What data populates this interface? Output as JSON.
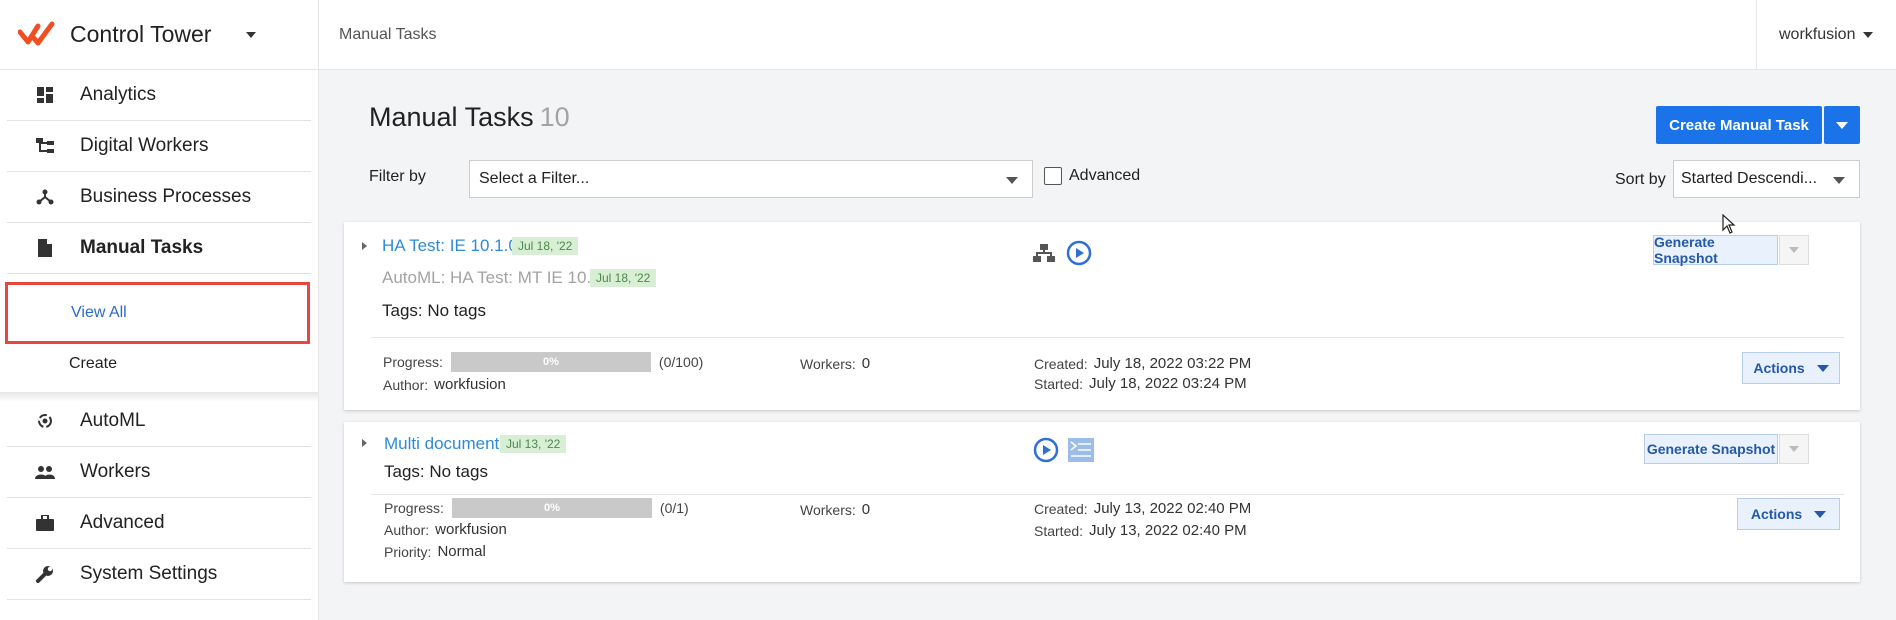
{
  "app": {
    "title": "Control Tower"
  },
  "header": {
    "breadcrumb": "Manual Tasks",
    "user": "workfusion"
  },
  "sidebar": {
    "items": [
      {
        "label": "Analytics",
        "icon": "dashboard-icon"
      },
      {
        "label": "Digital Workers",
        "icon": "workers-tree-icon"
      },
      {
        "label": "Business Processes",
        "icon": "process-graph-icon"
      },
      {
        "label": "Manual Tasks",
        "icon": "document-icon"
      },
      {
        "label": "AutoML",
        "icon": "automl-icon"
      },
      {
        "label": "Workers",
        "icon": "people-icon"
      },
      {
        "label": "Advanced",
        "icon": "briefcase-icon"
      },
      {
        "label": "System Settings",
        "icon": "wrench-icon"
      }
    ],
    "sub_items": [
      {
        "label": "View All"
      },
      {
        "label": "Create"
      }
    ]
  },
  "page": {
    "title": "Manual Tasks",
    "count": "10",
    "create_label": "Create Manual Task",
    "filter_label": "Filter by",
    "filter_value": "Select a Filter...",
    "advanced_label": "Advanced",
    "sort_label": "Sort by",
    "sort_value": "Started Descendi..."
  },
  "tasks": [
    {
      "title": "HA Test: IE 10.1.0.2",
      "date": "Jul 18, '22",
      "subtitle": "AutoML: HA Test: MT IE 10.1.0.2",
      "subtitle_date": "Jul 18, '22",
      "tags": "Tags: No tags",
      "snapshot_label": "Generate Snapshot",
      "actions_label": "Actions",
      "progress_label": "Progress:",
      "progress_pct": "0%",
      "progress_value": 0,
      "progress_frac": "(0/100)",
      "author_label": "Author:",
      "author": "workfusion",
      "workers_label": "Workers:",
      "workers": "0",
      "created_label": "Created:",
      "created": "July 18, 2022 03:22 PM",
      "started_label": "Started:",
      "started": "July 18, 2022 03:24 PM"
    },
    {
      "title": "Multi documents",
      "date": "Jul 13, '22",
      "tags": "Tags: No tags",
      "snapshot_label": "Generate Snapshot",
      "actions_label": "Actions",
      "progress_label": "Progress:",
      "progress_pct": "0%",
      "progress_value": 0,
      "progress_frac": "(0/1)",
      "author_label": "Author:",
      "author": "workfusion",
      "priority_label": "Priority:",
      "priority": "Normal",
      "workers_label": "Workers:",
      "workers": "0",
      "created_label": "Created:",
      "created": "July 13, 2022 02:40 PM",
      "started_label": "Started:",
      "started": "July 13, 2022 02:40 PM"
    }
  ],
  "colors": {
    "accent": "#1a73e8",
    "brand": "#f04e23",
    "link": "#2e8ad8",
    "highlight": "#e8473f"
  }
}
